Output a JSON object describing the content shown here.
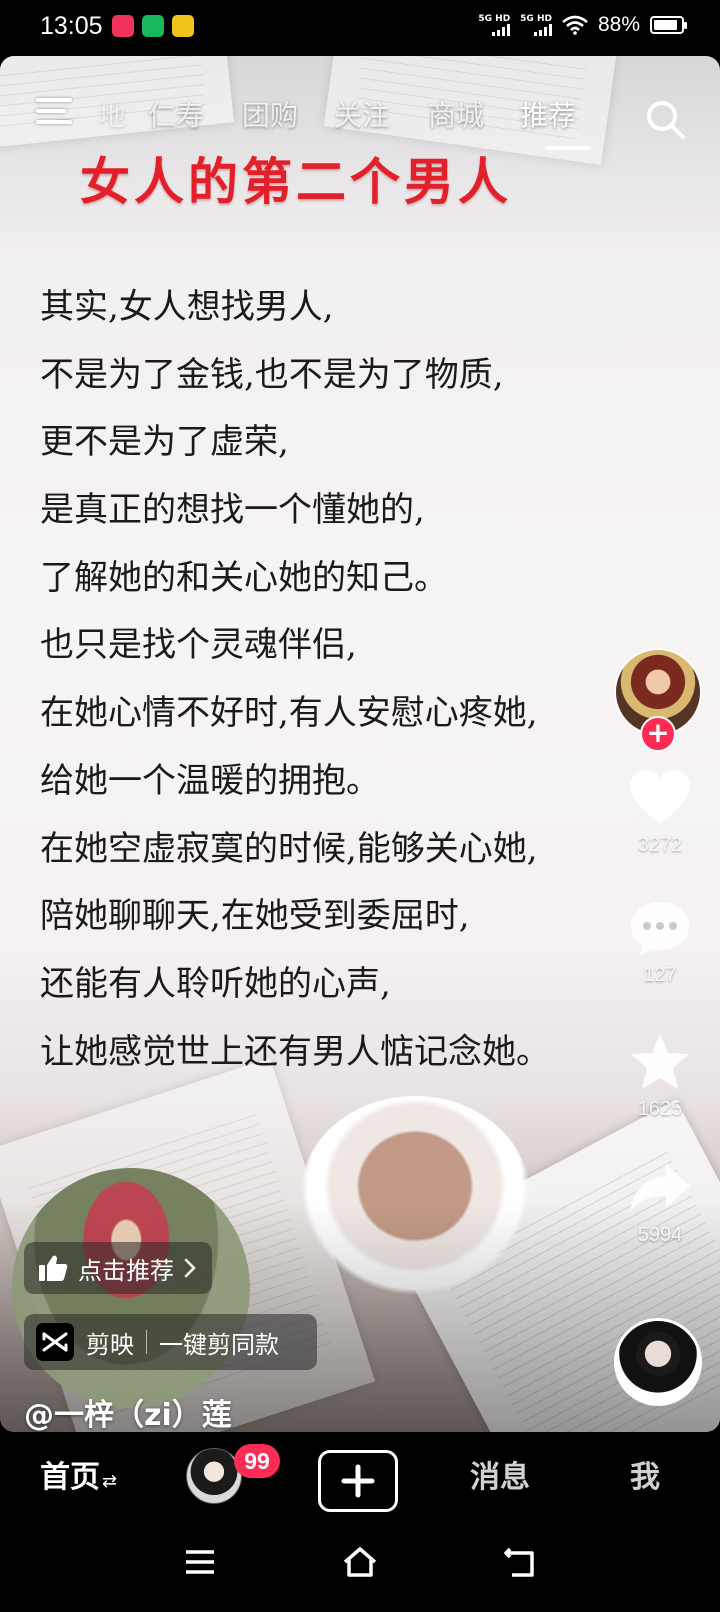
{
  "status_bar": {
    "time": "13:05",
    "sim1_label": "5G HD",
    "sim2_label": "5G HD",
    "battery_text": "88%",
    "battery_level": 0.88,
    "app_icon_colors": [
      "#f0335a",
      "#18b75c",
      "#f2c31a"
    ]
  },
  "top_nav": {
    "partial_tab": "地",
    "tabs": [
      "仁寿",
      "团购",
      "关注",
      "商城",
      "推荐"
    ],
    "active_tab": "推荐"
  },
  "post": {
    "title": "女人的第二个男人",
    "lines": [
      "其实,女人想找男人,",
      "不是为了金钱,也不是为了物质,",
      "更不是为了虚荣,",
      "是真正的想找一个懂她的,",
      "了解她的和关心她的知己。",
      "也只是找个灵魂伴侣,",
      "在她心情不好时,有人安慰心疼她,",
      "给她一个温暖的拥抱。",
      "在她空虚寂寞的时候,能够关心她,",
      "陪她聊聊天,在她受到委屈时,",
      "还能有人聆听她的心声,",
      "让她感觉世上还有男人惦记念她。"
    ]
  },
  "rail": {
    "follow_symbol": "+",
    "likes": "3272",
    "comments": "127",
    "favorites": "1625",
    "shares": "5994"
  },
  "overlay": {
    "recommend_label": "点击推荐",
    "capcut_name": "剪映",
    "capcut_action": "一键剪同款",
    "author": "@一梓（zi）莲"
  },
  "bottom_nav": {
    "home": "首页",
    "badge": "99",
    "messages": "消息",
    "me": "我"
  },
  "icons": {
    "menu": "menu-icon",
    "search": "search-icon",
    "like": "heart-icon",
    "comment": "comment-icon",
    "favorite": "star-icon",
    "share": "share-icon",
    "create": "plus-icon"
  },
  "colors": {
    "title_red": "#e3202a",
    "accent_pink": "#fe2c55",
    "background": "#000000"
  }
}
